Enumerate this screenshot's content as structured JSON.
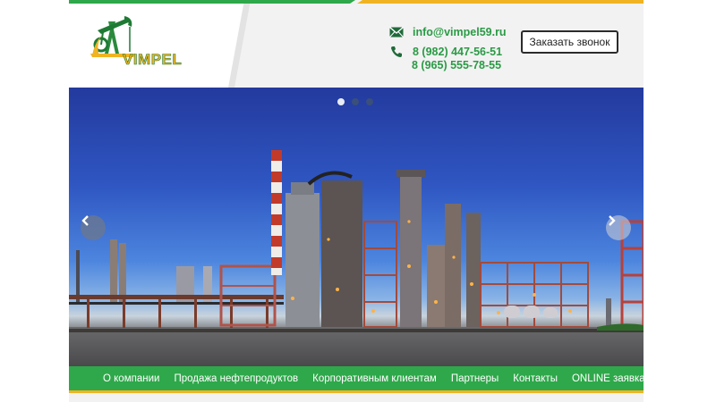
{
  "header": {
    "logo_text": "VIMPEL",
    "email": "info@vimpel59.ru",
    "phone_1": "8 (982) 447-56-51",
    "phone_2": "8 (965) 555-78-55",
    "callback_label": "Заказать звонок",
    "icons": {
      "email": "envelope-icon",
      "phone": "phone-icon"
    }
  },
  "slider": {
    "slide_count": 3,
    "active_slide": 1,
    "icons": {
      "prev": "chevron-left-icon",
      "next": "chevron-right-icon"
    }
  },
  "nav": {
    "items": [
      {
        "label": "О компании"
      },
      {
        "label": "Продажа нефтепродуктов"
      },
      {
        "label": "Корпоративным клиентам"
      },
      {
        "label": "Партнеры"
      },
      {
        "label": "Контакты"
      },
      {
        "label": "ONLINE заявка"
      }
    ]
  },
  "colors": {
    "brand_green": "#2ea84a",
    "brand_yellow": "#f0b323",
    "sky_blue": "#2f56c2"
  }
}
